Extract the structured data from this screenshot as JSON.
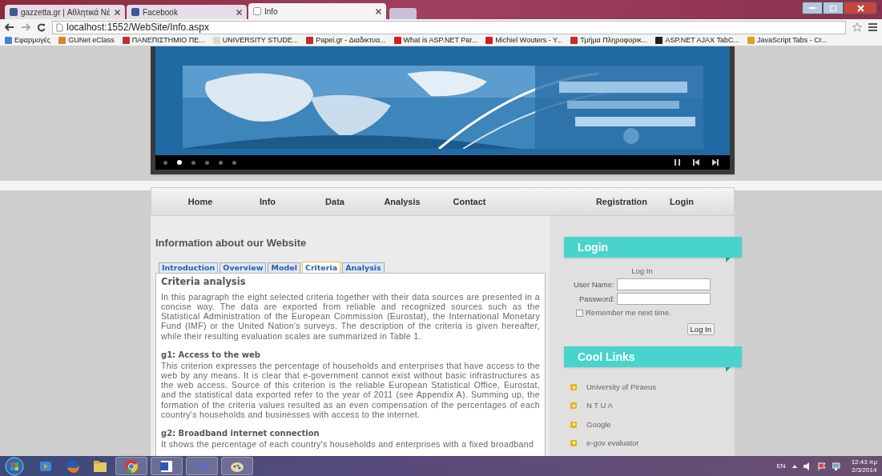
{
  "browser": {
    "tabs": [
      {
        "title": "gazzetta.gr | Αθλητικά Νέ",
        "selected": false
      },
      {
        "title": "Facebook",
        "selected": false
      },
      {
        "title": "Info",
        "selected": true
      }
    ],
    "address": "localhost:1552/WebSite/Info.aspx",
    "bookmarks": [
      {
        "label": "Εφαρμογές",
        "color": "#4a7fd0"
      },
      {
        "label": "GUNet eClass",
        "color": "#d08a2a"
      },
      {
        "label": "ΠΑΝΕΠΙΣΤΗΜΙΟ ΠΕ...",
        "color": "#c03030"
      },
      {
        "label": "UNIVERSITY STUDE...",
        "color": "#d8d8d8"
      },
      {
        "label": "Papei.gr - Διαδικτυα...",
        "color": "#c03030"
      },
      {
        "label": "What is ASP.NET Par...",
        "color": "#d02020"
      },
      {
        "label": "Michiel Wouters - Y...",
        "color": "#d02020"
      },
      {
        "label": "Τμήμα Πληροφορικ...",
        "color": "#c03030"
      },
      {
        "label": "ASP.NET AJAX TabC...",
        "color": "#202020"
      },
      {
        "label": "JavaScript Tabs - Cr...",
        "color": "#e0a020"
      }
    ]
  },
  "slideshow": {
    "dots": [
      {
        "selected": false
      },
      {
        "selected": true
      },
      {
        "selected": false
      },
      {
        "selected": false
      },
      {
        "selected": false
      },
      {
        "selected": false
      }
    ]
  },
  "nav": {
    "items": [
      {
        "label": "Home"
      },
      {
        "label": "Info"
      },
      {
        "label": "Data"
      },
      {
        "label": "Analysis"
      },
      {
        "label": "Contact"
      }
    ],
    "right_items": [
      {
        "label": "Registration"
      },
      {
        "label": "Login"
      }
    ]
  },
  "content": {
    "heading": "Information about our Website",
    "tabs": [
      {
        "label": "Introduction",
        "selected": false
      },
      {
        "label": "Overview",
        "selected": false
      },
      {
        "label": "Model",
        "selected": false
      },
      {
        "label": "Criteria",
        "selected": true
      },
      {
        "label": "Analysis",
        "selected": false
      }
    ],
    "title": "Criteria analysis",
    "intro": "In this paragraph the eight selected criteria together with their data sources are presented in a concise way. The data are exported from reliable and recognized sources such as the Statistical Administration of the European Commission (Eurostat), the International Monetary Fund (IMF) or the United Nation's surveys. The description of the criteria is given hereafter, while their resulting evaluation scales are summarized in Table 1.",
    "criteria": [
      {
        "title": "g1: Access to the web",
        "text": "This criterion expresses the percentage of households and enterprises that have access to the web by any means. It is clear that e-government cannot exist without basic infrastructures as the web access. Source of this criterion is the reliable European Statistical Office, Eurostat, and the statistical data exported refer to the year of 2011 (see Appendix A). Summing up, the formation of the criteria values resulted as an even compensation of the percentages of each country's households and businesses with access to the internet."
      },
      {
        "title": "g2: Broadband internet connection",
        "text": "It shows the percentage of each country's households and enterprises with a fixed broadband"
      }
    ]
  },
  "sidebar": {
    "login": {
      "title": "Login",
      "caption": "Log In",
      "user_label": "User Name:",
      "password_label": "Password:",
      "remember": {
        "label": "Remember me next time.",
        "checked": false
      },
      "button": "Log In"
    },
    "links": {
      "title": "Cool Links",
      "items": [
        {
          "label": "University of Piraeus"
        },
        {
          "label": "N T U A"
        },
        {
          "label": "Google"
        },
        {
          "label": "e-gov evaluator"
        }
      ]
    }
  },
  "taskbar": {
    "apps": [
      {
        "kind": "media",
        "selected": false
      },
      {
        "kind": "firefox",
        "selected": false
      },
      {
        "kind": "folder",
        "selected": false
      },
      {
        "kind": "chrome",
        "selected": true
      },
      {
        "kind": "word",
        "selected": true
      },
      {
        "kind": "infinity",
        "selected": true
      },
      {
        "kind": "paint",
        "selected": true
      }
    ],
    "language": "EN",
    "time": "12:43 πμ",
    "date": "2/3/2014"
  }
}
